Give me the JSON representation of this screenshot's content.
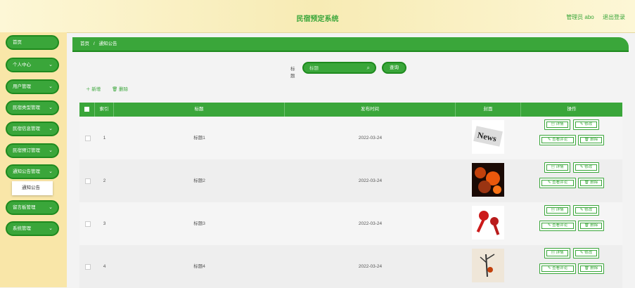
{
  "header": {
    "title": "民宿预定系统",
    "user": "管理员 abo",
    "logout": "退出登录"
  },
  "sidebar": {
    "items": [
      {
        "label": "首页",
        "has_chevron": false
      },
      {
        "label": "个人中心",
        "has_chevron": true
      },
      {
        "label": "用户管理",
        "has_chevron": true
      },
      {
        "label": "民宿类型管理",
        "has_chevron": true
      },
      {
        "label": "民宿信息管理",
        "has_chevron": true
      },
      {
        "label": "民宿预订管理",
        "has_chevron": true
      },
      {
        "label": "通知公告管理",
        "has_chevron": true
      },
      {
        "label": "留言板管理",
        "has_chevron": true
      },
      {
        "label": "系统管理",
        "has_chevron": true
      }
    ],
    "submenu": "通知公告"
  },
  "breadcrumb": {
    "home": "首页",
    "sep": "/",
    "current": "通知公告"
  },
  "search": {
    "label": "标题",
    "placeholder": "标题",
    "button": "查询"
  },
  "actions": {
    "add": "＋ 新增",
    "delete": "🗑 删除"
  },
  "table": {
    "headers": [
      "索引",
      "标题",
      "发布时间",
      "封面",
      "操作"
    ],
    "rows": [
      {
        "index": "1",
        "title": "标题1",
        "date": "2022-03-24",
        "cover": "news"
      },
      {
        "index": "2",
        "title": "标题2",
        "date": "2022-03-24",
        "cover": "fire"
      },
      {
        "index": "3",
        "title": "标题3",
        "date": "2022-03-24",
        "cover": "mic"
      },
      {
        "index": "4",
        "title": "标题4",
        "date": "2022-03-24",
        "cover": "tree"
      }
    ],
    "buttons": {
      "detail": "详情",
      "edit": "修改",
      "comments": "查看评论",
      "delete": "删除"
    }
  },
  "colors": {
    "accent": "#3aa63a",
    "accent_dark": "#1e8a1e",
    "sidebar_bg": "#f9e6a8",
    "header_bg": "#f7ebb4"
  }
}
